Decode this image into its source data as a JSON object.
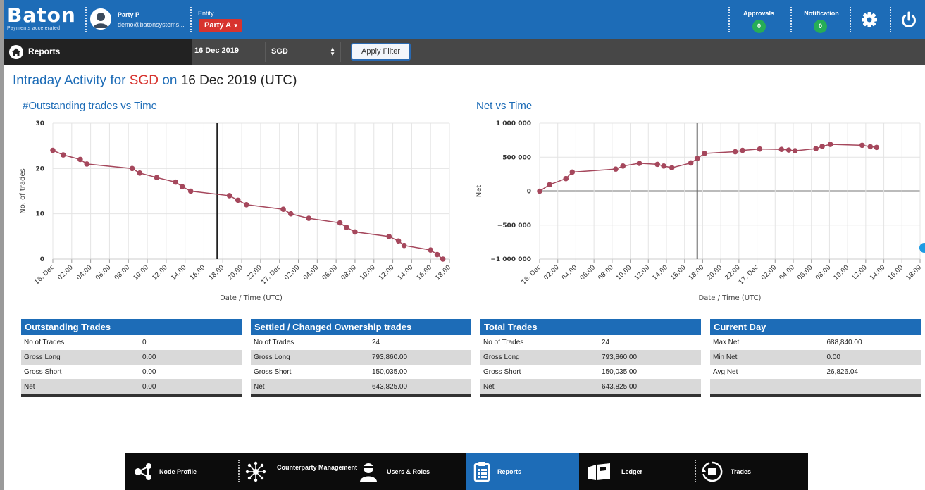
{
  "header": {
    "logo_text": "Baton",
    "logo_tagline": "Payments accelerated",
    "user_name": "Party P",
    "user_email": "demo@batonsystems...",
    "entity_label": "Entity",
    "entity_value": "Party A",
    "approvals_label": "Approvals",
    "approvals_count": "0",
    "notification_label": "Notification",
    "notification_count": "0",
    "colors": {
      "brand": "#1d6cb7",
      "alert": "#d7332e",
      "badge": "#26ad56"
    }
  },
  "toolbar": {
    "title": "Reports",
    "date": "16 Dec 2019",
    "currency": "SGD",
    "apply_label": "Apply Filter"
  },
  "page": {
    "title_prefix": "Intraday Activity for",
    "title_ccy": "SGD",
    "title_on": "on",
    "title_date": "16 Dec 2019 (UTC)"
  },
  "chart_data": [
    {
      "type": "line",
      "title": "#Outstanding trades vs Time",
      "xlabel": "Date / Time (UTC)",
      "ylabel": "No. of trades",
      "ylim": [
        0,
        30
      ],
      "yticks": [
        "0",
        "10",
        "20",
        "30"
      ],
      "xticks": [
        "16. Dec",
        "02:00",
        "04:00",
        "06:00",
        "08:00",
        "10:00",
        "12:00",
        "14:00",
        "16:00",
        "18:00",
        "20:00",
        "22:00",
        "17. Dec",
        "02:00",
        "04:00",
        "06:00",
        "08:00",
        "10:00",
        "12:00",
        "14:00",
        "16:00",
        "18:00"
      ],
      "xlim_hours": [
        0,
        42
      ],
      "marker_hours": 17.4,
      "grid": true,
      "color": "#a5475c",
      "x_hours": [
        0,
        1.1,
        2.9,
        3.6,
        8.4,
        9.2,
        11.0,
        13.0,
        13.7,
        14.6,
        18.7,
        19.6,
        20.5,
        24.4,
        25.2,
        27.1,
        30.4,
        31.1,
        32.0,
        35.6,
        36.6,
        37.2,
        40.0,
        40.7,
        41.3
      ],
      "values": [
        24,
        23,
        22,
        21,
        20,
        19,
        18,
        17,
        16,
        15,
        14,
        13,
        12,
        11,
        10,
        9,
        8,
        7,
        6,
        5,
        4,
        3,
        2,
        1,
        0
      ]
    },
    {
      "type": "line",
      "title": "Net vs Time",
      "xlabel": "Date / Time (UTC)",
      "ylabel": "Net",
      "ylim": [
        -1000000,
        1000000
      ],
      "yticks": [
        "−1 000 000",
        "−500 000",
        "0",
        "500 000",
        "1 000 000"
      ],
      "xticks": [
        "16. Dec",
        "02:00",
        "04:00",
        "06:00",
        "08:00",
        "10:00",
        "12:00",
        "14:00",
        "16:00",
        "18:00",
        "20:00",
        "22:00",
        "17. Dec",
        "02:00",
        "04:00",
        "06:00",
        "08:00",
        "10:00",
        "12:00",
        "14:00",
        "16:00",
        "18:00"
      ],
      "xlim_hours": [
        0,
        42
      ],
      "marker_hours": 17.4,
      "grid": true,
      "color": "#a5475c",
      "x_hours": [
        0,
        1.1,
        2.9,
        3.6,
        8.4,
        9.2,
        11.0,
        13.0,
        13.7,
        14.6,
        16.7,
        17.4,
        18.2,
        21.6,
        22.4,
        24.3,
        26.7,
        27.5,
        28.2,
        30.5,
        31.2,
        32.1,
        35.6,
        36.5,
        37.2
      ],
      "values": [
        0,
        95000,
        185000,
        280000,
        325000,
        370000,
        410000,
        395000,
        370000,
        345000,
        415000,
        480000,
        555000,
        580000,
        600000,
        620000,
        615000,
        605000,
        595000,
        625000,
        660000,
        688840,
        675000,
        655000,
        643825
      ]
    }
  ],
  "tables": [
    {
      "title": "Outstanding Trades",
      "rows": [
        [
          "No of Trades",
          "0"
        ],
        [
          "Gross Long",
          "0.00"
        ],
        [
          "Gross Short",
          "0.00"
        ],
        [
          "Net",
          "0.00"
        ]
      ]
    },
    {
      "title": "Settled / Changed Ownership trades",
      "rows": [
        [
          "No of Trades",
          "24"
        ],
        [
          "Gross Long",
          "793,860.00"
        ],
        [
          "Gross Short",
          "150,035.00"
        ],
        [
          "Net",
          "643,825.00"
        ]
      ]
    },
    {
      "title": "Total Trades",
      "rows": [
        [
          "No of Trades",
          "24"
        ],
        [
          "Gross Long",
          "793,860.00"
        ],
        [
          "Gross Short",
          "150,035.00"
        ],
        [
          "Net",
          "643,825.00"
        ]
      ]
    },
    {
      "title": "Current Day",
      "rows": [
        [
          "Max Net",
          "688,840.00"
        ],
        [
          "Min Net",
          "0.00"
        ],
        [
          "Avg Net",
          "26,826.04"
        ],
        [
          "",
          ""
        ]
      ]
    }
  ],
  "bottom_nav": [
    {
      "label": "Node Profile",
      "icon": "node-profile-icon"
    },
    {
      "label": "Counterparty Management",
      "icon": "counterparty-icon"
    },
    {
      "label": "Users & Roles",
      "icon": "users-roles-icon"
    },
    {
      "label": "Reports",
      "icon": "reports-icon",
      "active": true
    },
    {
      "label": "Ledger",
      "icon": "ledger-icon"
    },
    {
      "label": "Trades",
      "icon": "trades-icon"
    }
  ]
}
